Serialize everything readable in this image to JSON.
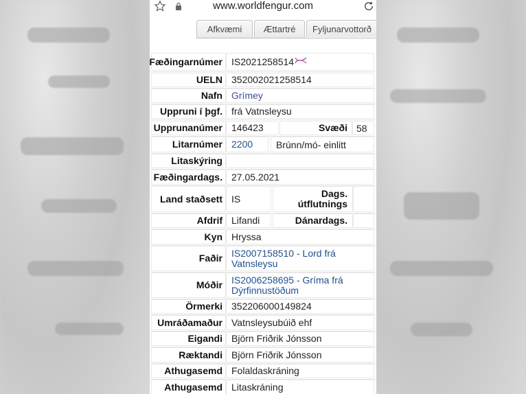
{
  "browser": {
    "url": "www.worldfengur.com"
  },
  "tabs": [
    {
      "label": "Afkvæmi"
    },
    {
      "label": "Ættartré"
    },
    {
      "label": "Fyljunarvottorð"
    }
  ],
  "record": {
    "faedingarnumer": {
      "label": "Fæðingarnúmer",
      "value": "IS2021258514"
    },
    "ueln": {
      "label": "UELN",
      "value": "352002021258514"
    },
    "nafn": {
      "label": "Nafn",
      "value": "Grímey"
    },
    "uppruni": {
      "label": "Uppruni í þgf.",
      "value": "frá Vatnsleysu"
    },
    "upprunanumer": {
      "label": "Upprunanúmer",
      "value": "146423",
      "label2": "Svæði",
      "value2": "58"
    },
    "litarnumer": {
      "label": "Litarnúmer",
      "value": "2200",
      "value2": "Brúnn/mó- einlitt"
    },
    "litaskyring": {
      "label": "Litaskýring",
      "value": ""
    },
    "faedingardags": {
      "label": "Fæðingardags.",
      "value": "27.05.2021"
    },
    "land": {
      "label": "Land staðsett",
      "value": "IS",
      "label2": "Dags. útflutnings",
      "value2": ""
    },
    "afdrif": {
      "label": "Afdrif",
      "value": "Lifandi",
      "label2": "Dánardags.",
      "value2": ""
    },
    "kyn": {
      "label": "Kyn",
      "value": "Hryssa"
    },
    "fadir": {
      "label": "Faðir",
      "value": "IS2007158510 - Lord frá Vatnsleysu"
    },
    "modir": {
      "label": "Móðir",
      "value": "IS2006258695 - Gríma frá Dýrfinnustöðum"
    },
    "ormerki": {
      "label": "Örmerki",
      "value": "352206000149824"
    },
    "umradamadur": {
      "label": "Umráðamaður",
      "value": "Vatnsleysubúið ehf"
    },
    "eigandi": {
      "label": "Eigandi",
      "value": "Björn Friðrik Jónsson"
    },
    "raektandi": {
      "label": "Ræktandi",
      "value": "Björn Friðrik Jónsson"
    },
    "athugasemd1": {
      "label": "Athugasemd",
      "value": "Folaldaskráning"
    },
    "athugasemd2": {
      "label": "Athugasemd",
      "value": "Litaskráning"
    }
  },
  "icons": {
    "star": "star-outline-icon",
    "lock": "lock-icon",
    "reload": "reload-icon",
    "dna": "dna-icon"
  }
}
